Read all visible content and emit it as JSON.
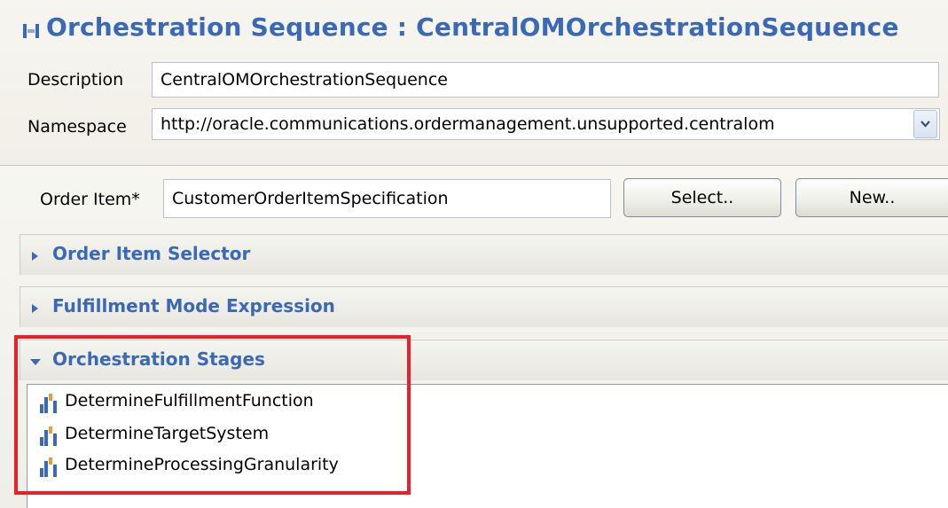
{
  "header": {
    "title": "Orchestration Sequence : CentralOMOrchestrationSequence",
    "description_label": "Description",
    "description_value": "CentralOMOrchestrationSequence",
    "namespace_label": "Namespace",
    "namespace_value": "http://oracle.communications.ordermanagement.unsupported.centralom"
  },
  "order_item": {
    "label": "Order Item",
    "required_marker": "*",
    "value": "CustomerOrderItemSpecification",
    "select_label": "Select..",
    "new_label": "New.."
  },
  "sections": {
    "order_item_selector": "Order Item Selector",
    "fulfillment_mode_expression": "Fulfillment Mode Expression",
    "orchestration_stages": "Orchestration Stages"
  },
  "stages": [
    "DetermineFulfillmentFunction",
    "DetermineTargetSystem",
    "DetermineProcessingGranularity"
  ],
  "colors": {
    "accent": "#3a69b8",
    "highlight": "#e8202a"
  },
  "icons": {
    "title": "sequence-icon",
    "stage": "stage-icon",
    "collapsed": "triangle-right-icon",
    "expanded": "triangle-down-icon",
    "dropdown": "chevron-down-icon"
  }
}
